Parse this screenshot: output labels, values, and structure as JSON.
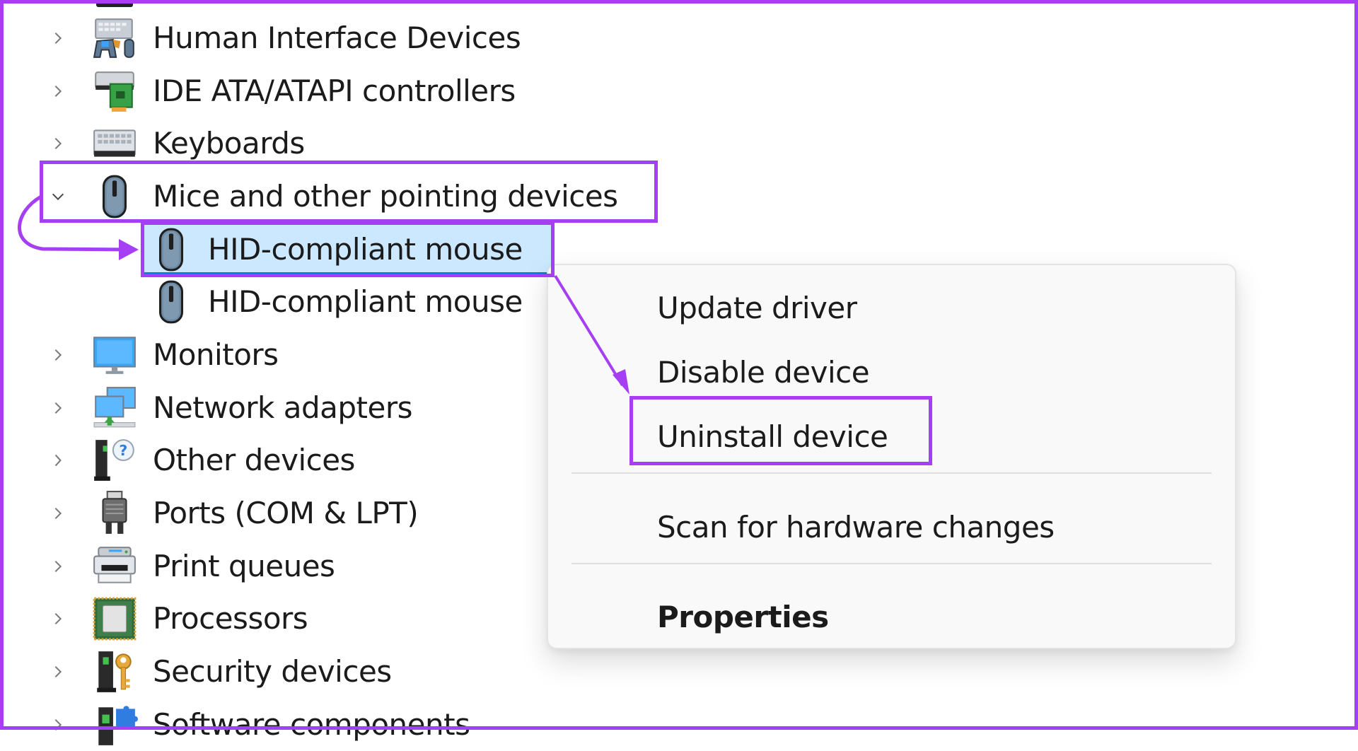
{
  "tree": {
    "items": [
      {
        "label": "Human Interface Devices",
        "icon": "hid-icon",
        "expanded": false
      },
      {
        "label": "IDE ATA/ATAPI controllers",
        "icon": "ide-controller-icon",
        "expanded": false
      },
      {
        "label": "Keyboards",
        "icon": "keyboard-icon",
        "expanded": false
      },
      {
        "label": "Mice and other pointing devices",
        "icon": "mouse-icon",
        "expanded": true,
        "children": [
          {
            "label": "HID-compliant mouse",
            "icon": "mouse-icon",
            "selected": true
          },
          {
            "label": "HID-compliant mouse",
            "icon": "mouse-icon",
            "selected": false
          }
        ]
      },
      {
        "label": "Monitors",
        "icon": "monitor-icon",
        "expanded": false
      },
      {
        "label": "Network adapters",
        "icon": "network-adapter-icon",
        "expanded": false
      },
      {
        "label": "Other devices",
        "icon": "other-device-icon",
        "expanded": false
      },
      {
        "label": "Ports (COM & LPT)",
        "icon": "port-icon",
        "expanded": false
      },
      {
        "label": "Print queues",
        "icon": "printer-icon",
        "expanded": false
      },
      {
        "label": "Processors",
        "icon": "processor-icon",
        "expanded": false
      },
      {
        "label": "Security devices",
        "icon": "security-device-icon",
        "expanded": false
      },
      {
        "label": "Software components",
        "icon": "software-component-icon",
        "expanded": false
      }
    ]
  },
  "context_menu": {
    "items": [
      {
        "label": "Update driver"
      },
      {
        "label": "Disable device"
      },
      {
        "label": "Uninstall device",
        "highlighted": true
      },
      {
        "label": "Scan for hardware changes"
      },
      {
        "label": "Properties",
        "bold": true
      }
    ]
  },
  "annotation": {
    "accent_color": "#a63ff3",
    "selection_color": "#cce8ff"
  }
}
